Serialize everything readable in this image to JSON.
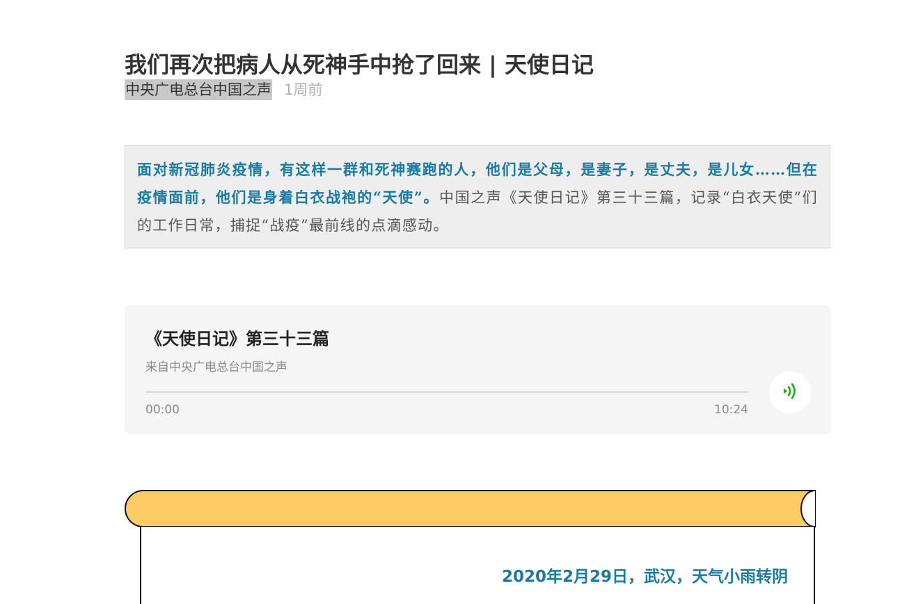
{
  "article": {
    "title": "我们再次把病人从死神手中抢了回来 | 天使日记",
    "author": "中央广电总台中国之声",
    "time": "1周前"
  },
  "summary": {
    "highlight": "面对新冠肺炎疫情，有这样一群和死神赛跑的人，他们是父母，是妻子，是丈夫，是儿女……但在疫情面前，他们是身着白衣战袍的“天使”。",
    "rest": "中国之声《天使日记》第三十三篇，记录“白衣天使”们的工作日常，捕捉“战疫”最前线的点滴感动。"
  },
  "audio": {
    "title": "《天使日记》第三十三篇",
    "source": "来自中央广电总台中国之声",
    "current_time": "00:00",
    "duration": "10:24",
    "progress_fraction": 0,
    "play_icon": "audio-wave-icon",
    "accent_color": "#1aad19"
  },
  "scroll": {
    "date_line": "2020年2月29日，武汉，天气小雨转阴",
    "roll_color": "#fecb65"
  },
  "colors": {
    "highlight_text": "#1a7aa0",
    "summary_bg": "#eeeeee",
    "card_bg": "#f5f5f5"
  }
}
